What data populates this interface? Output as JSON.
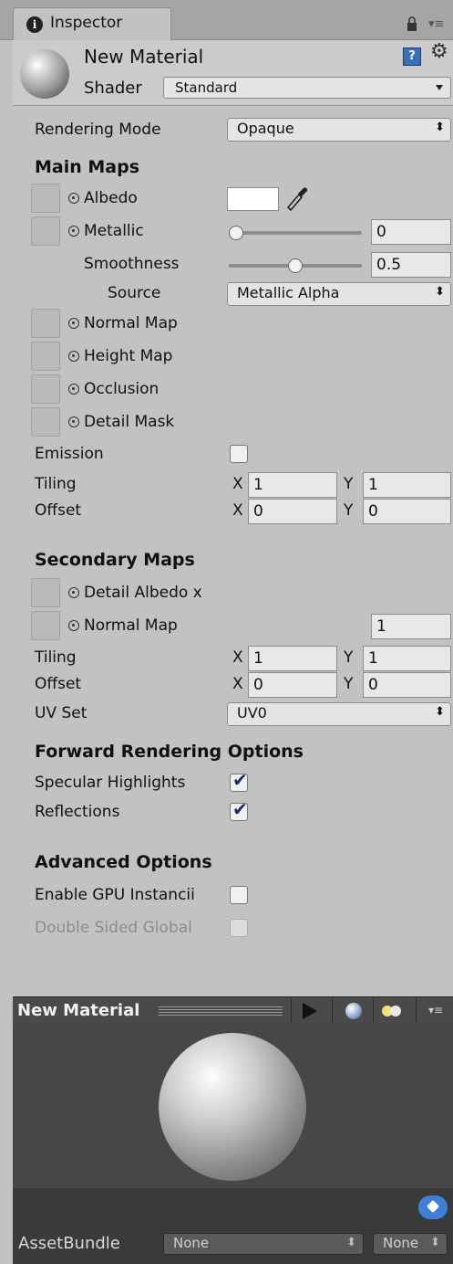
{
  "tab": {
    "icon": "info-icon",
    "icon_glyph": "i",
    "label": "Inspector"
  },
  "header": {
    "material_name": "New Material",
    "help_icon": "?",
    "shader_label": "Shader",
    "shader_value": "Standard"
  },
  "rendering_mode": {
    "label": "Rendering Mode",
    "value": "Opaque"
  },
  "main_maps": {
    "title": "Main Maps",
    "albedo": "Albedo",
    "metallic": {
      "label": "Metallic",
      "value": "0",
      "level": 0
    },
    "smoothness": {
      "label": "Smoothness",
      "value": "0.5",
      "level": 0.5
    },
    "source": {
      "label": "Source",
      "value": "Metallic Alpha"
    },
    "normal_map": "Normal Map",
    "height_map": "Height Map",
    "occlusion": "Occlusion",
    "detail_mask": "Detail Mask",
    "emission": "Emission",
    "tiling": {
      "label": "Tiling",
      "x_label": "X",
      "x": "1",
      "y_label": "Y",
      "y": "1"
    },
    "offset": {
      "label": "Offset",
      "x_label": "X",
      "x": "0",
      "y_label": "Y",
      "y": "0"
    }
  },
  "secondary_maps": {
    "title": "Secondary Maps",
    "detail_albedo": "Detail Albedo x",
    "normal_map": "Normal Map",
    "normal_value": "1",
    "tiling": {
      "label": "Tiling",
      "x_label": "X",
      "x": "1",
      "y_label": "Y",
      "y": "1"
    },
    "offset": {
      "label": "Offset",
      "x_label": "X",
      "x": "0",
      "y_label": "Y",
      "y": "0"
    },
    "uv_set": {
      "label": "UV Set",
      "value": "UV0"
    }
  },
  "forward_rendering": {
    "title": "Forward Rendering Options",
    "specular_highlights": "Specular Highlights",
    "specular_checked": true,
    "reflections": "Reflections",
    "reflections_checked": true
  },
  "advanced": {
    "title": "Advanced Options",
    "gpu_instancing": "Enable GPU Instancii",
    "double_sided": "Double Sided Global"
  },
  "preview": {
    "title": "New Material"
  },
  "asset_bundle": {
    "label": "AssetBundle",
    "bundle_value": "None",
    "variant_value": "None"
  },
  "colors": {
    "panel_bg": "#c2c2c2",
    "preview_bg": "#474747",
    "tag_blue": "#3f7fd8"
  }
}
